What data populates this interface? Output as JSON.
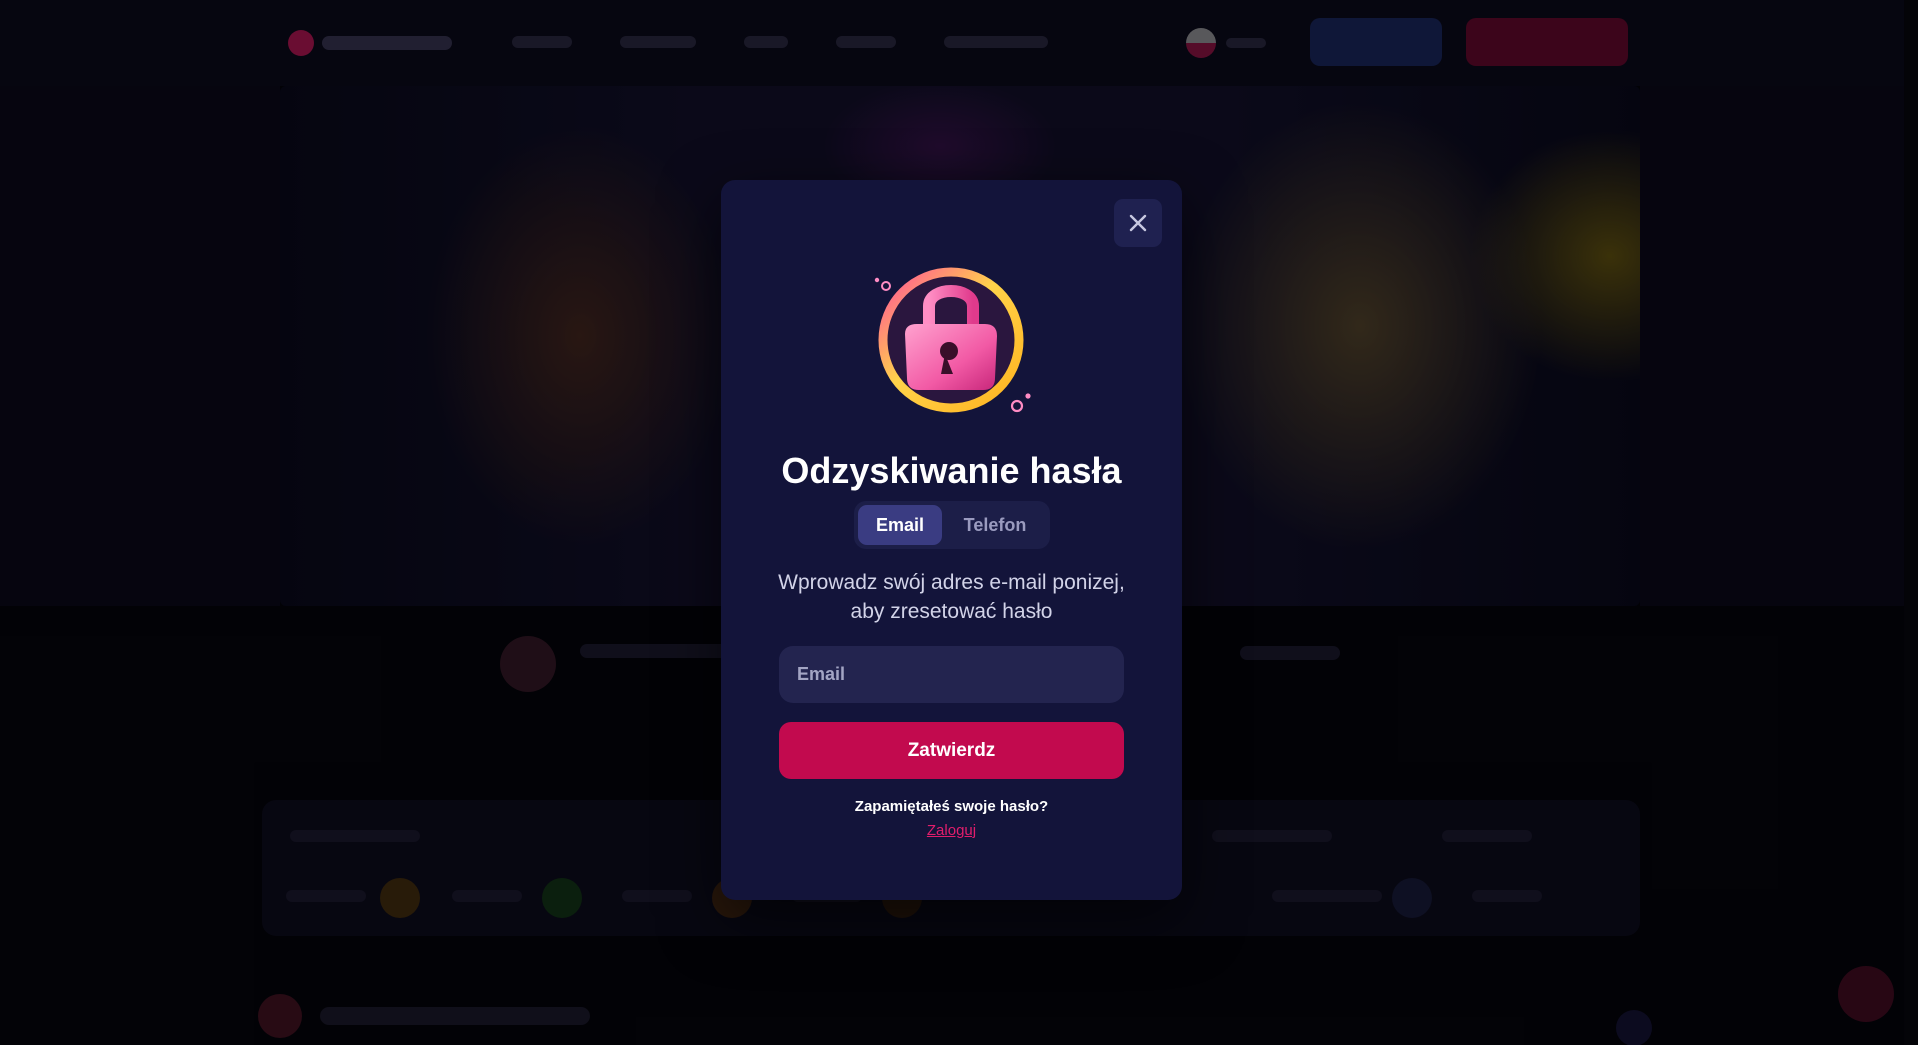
{
  "modal": {
    "title": "Odzyskiwanie hasła",
    "tabs": [
      {
        "label": "Email",
        "active": true
      },
      {
        "label": "Telefon",
        "active": false
      }
    ],
    "instructions": "Wprowadz swój adres e-mail ponizej, aby zresetować hasło",
    "email_field": {
      "placeholder": "Email",
      "value": ""
    },
    "submit_label": "Zatwierdz",
    "remember_question": "Zapamiętałeś swoje hasło?",
    "login_link": "Zaloguj",
    "close_icon": "close-icon",
    "illustration_icon": "padlock-icon"
  },
  "colors": {
    "modal_bg": "#13143a",
    "accent": "#c20a4e",
    "link": "#e21d6c",
    "tab_active": "#3a3c82",
    "input_bg": "#23244f"
  }
}
